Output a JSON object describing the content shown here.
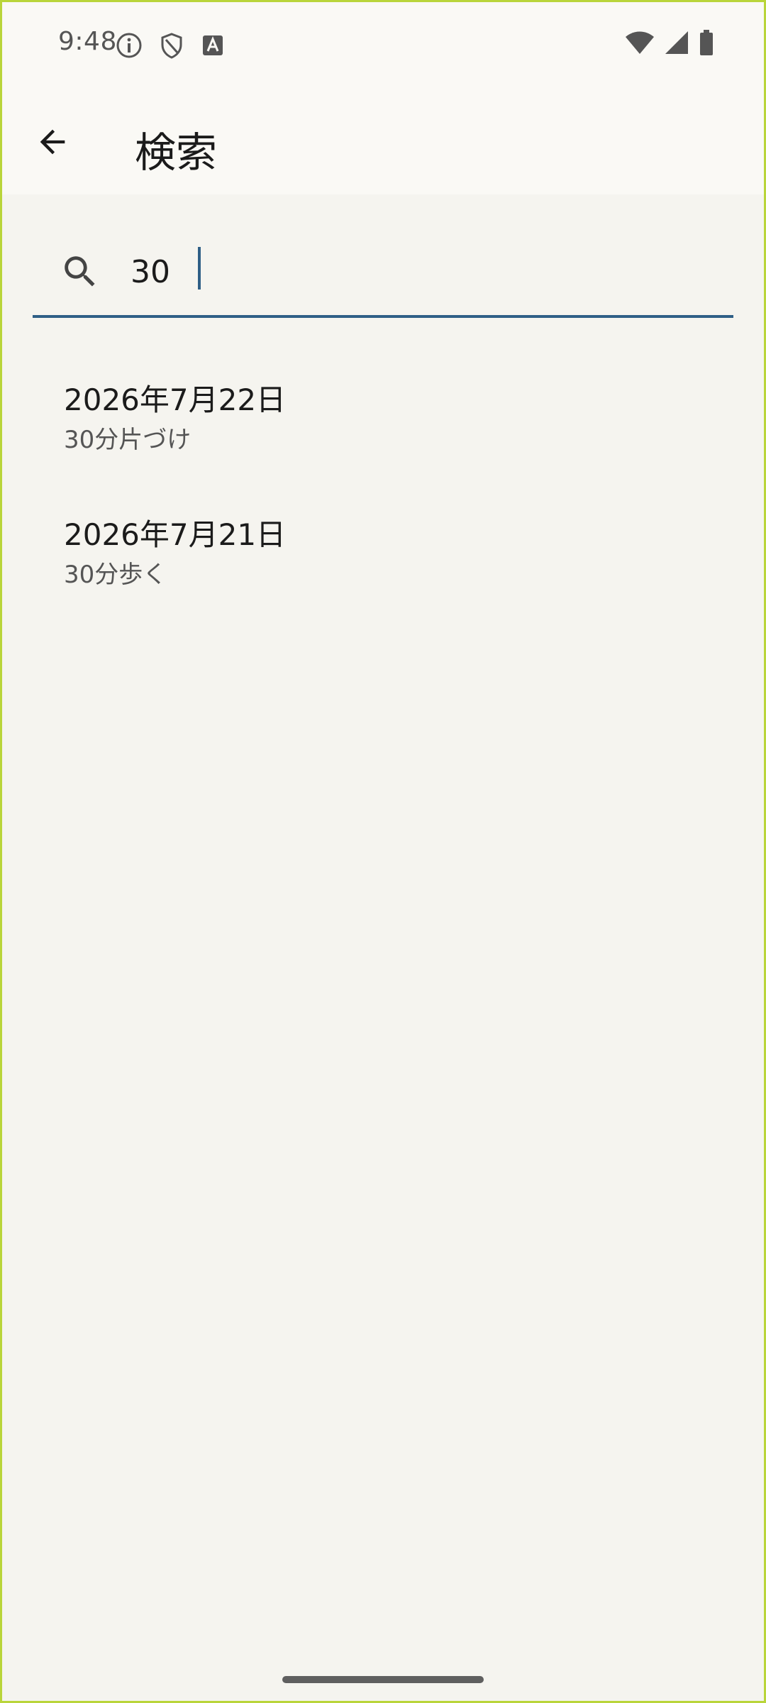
{
  "status_bar": {
    "time": "9:48",
    "icons_left": [
      "info-icon",
      "shield-icon",
      "keyboard-a-icon"
    ],
    "icons_right": [
      "wifi-icon",
      "cellular-signal-icon",
      "battery-icon"
    ]
  },
  "app_bar": {
    "back_icon": "arrow-back-icon",
    "title": "検索"
  },
  "search": {
    "icon": "search-icon",
    "value": "30",
    "accent_color": "#2f5f86"
  },
  "results": [
    {
      "date": "2026年7月22日",
      "text": "30分片づけ"
    },
    {
      "date": "2026年7月21日",
      "text": "30分歩く"
    }
  ],
  "colors": {
    "background": "#f5f4ef",
    "bar_background": "#faf9f5",
    "accent": "#2f5f86"
  }
}
